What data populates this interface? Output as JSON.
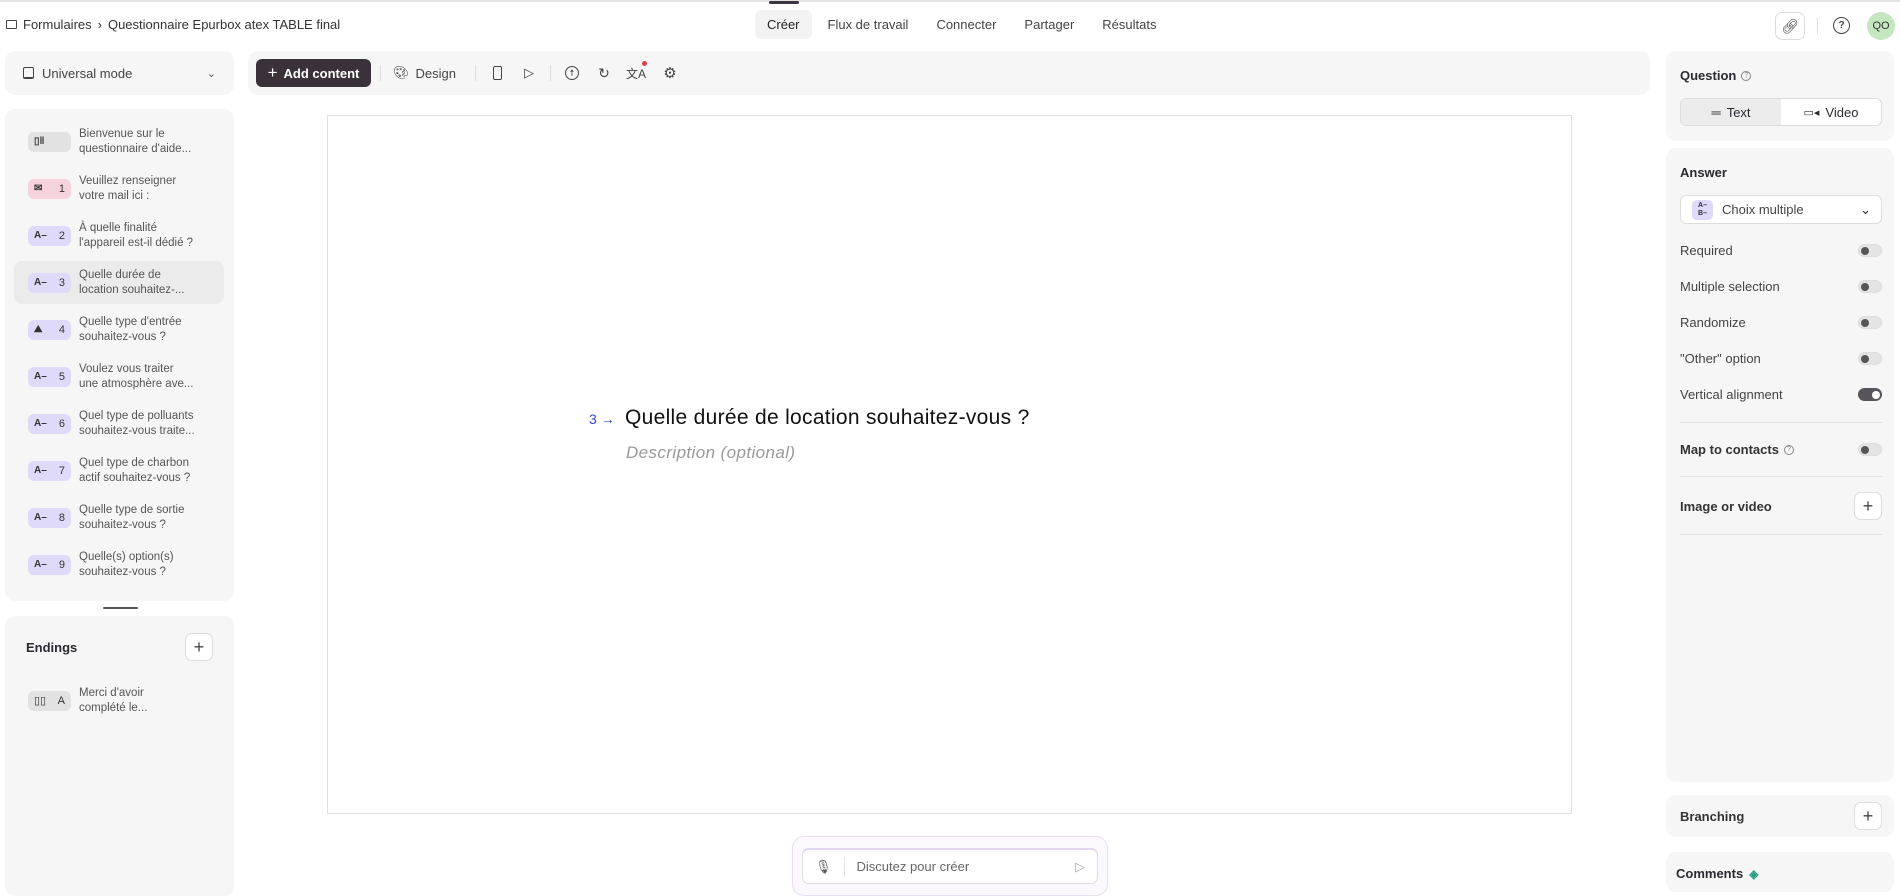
{
  "breadcrumb": {
    "root": "Formulaires",
    "separator": "›",
    "current": "Questionnaire Epurbox atex TABLE final"
  },
  "tabs": [
    "Créer",
    "Flux de travail",
    "Connecter",
    "Partager",
    "Résultats"
  ],
  "user": {
    "initials": "QO",
    "avatar_color": "#c6e6c0"
  },
  "mode": {
    "label": "Universal mode"
  },
  "toolbar": {
    "add_content": "Add content",
    "design": "Design"
  },
  "questions": [
    {
      "num": "",
      "l1": "Bienvenue sur le",
      "l2": "questionnaire d'aide...",
      "type": "welcome",
      "color": "#e2e2e2"
    },
    {
      "num": "1",
      "l1": "Veuillez renseigner",
      "l2": "votre mail ici :",
      "type": "email",
      "color": "#f6d3dc"
    },
    {
      "num": "2",
      "l1": "À quelle finalité",
      "l2": "l'appareil est-il dédié ?",
      "type": "choice",
      "color": "#e0dafa"
    },
    {
      "num": "3",
      "l1": "Quelle durée de",
      "l2": "location souhaitez-...",
      "type": "choice",
      "color": "#e0dafa"
    },
    {
      "num": "4",
      "l1": "Quelle type d'entrée",
      "l2": "souhaitez-vous ?",
      "type": "picture",
      "color": "#e0dafa"
    },
    {
      "num": "5",
      "l1": "Voulez vous traiter",
      "l2": "une atmosphère ave...",
      "type": "choice",
      "color": "#e0dafa"
    },
    {
      "num": "6",
      "l1": "Quel type de polluants",
      "l2": "souhaitez-vous traite...",
      "type": "choice",
      "color": "#e0dafa"
    },
    {
      "num": "7",
      "l1": "Quel type de charbon",
      "l2": "actif souhaitez-vous ?",
      "type": "choice",
      "color": "#e0dafa"
    },
    {
      "num": "8",
      "l1": "Quelle type de sortie",
      "l2": "souhaitez-vous ?",
      "type": "choice",
      "color": "#e0dafa"
    },
    {
      "num": "9",
      "l1": "Quelle(s) option(s)",
      "l2": "souhaitez-vous ?",
      "type": "choice",
      "color": "#e0dafa"
    }
  ],
  "endings": {
    "title": "Endings",
    "items": [
      {
        "num": "A",
        "l1": "Merci d'avoir",
        "l2": "complété le..."
      }
    ]
  },
  "canvas": {
    "number": "3",
    "arrow": "→",
    "question": "Quelle durée de location souhaitez-vous ?",
    "description_placeholder": "Description (optional)"
  },
  "chat": {
    "placeholder": "Discutez pour créer"
  },
  "right": {
    "question_title": "Question",
    "text_tab": "Text",
    "video_tab": "Video",
    "answer_title": "Answer",
    "answer_type": "Choix multiple",
    "toggles": [
      {
        "label": "Required",
        "on": false
      },
      {
        "label": "Multiple selection",
        "on": false
      },
      {
        "label": "Randomize",
        "on": false
      },
      {
        "label": "\"Other\" option",
        "on": false
      },
      {
        "label": "Vertical alignment",
        "on": true
      }
    ],
    "map_contacts": "Map to contacts",
    "image_video": "Image or video",
    "branching": "Branching",
    "comments": "Comments"
  }
}
